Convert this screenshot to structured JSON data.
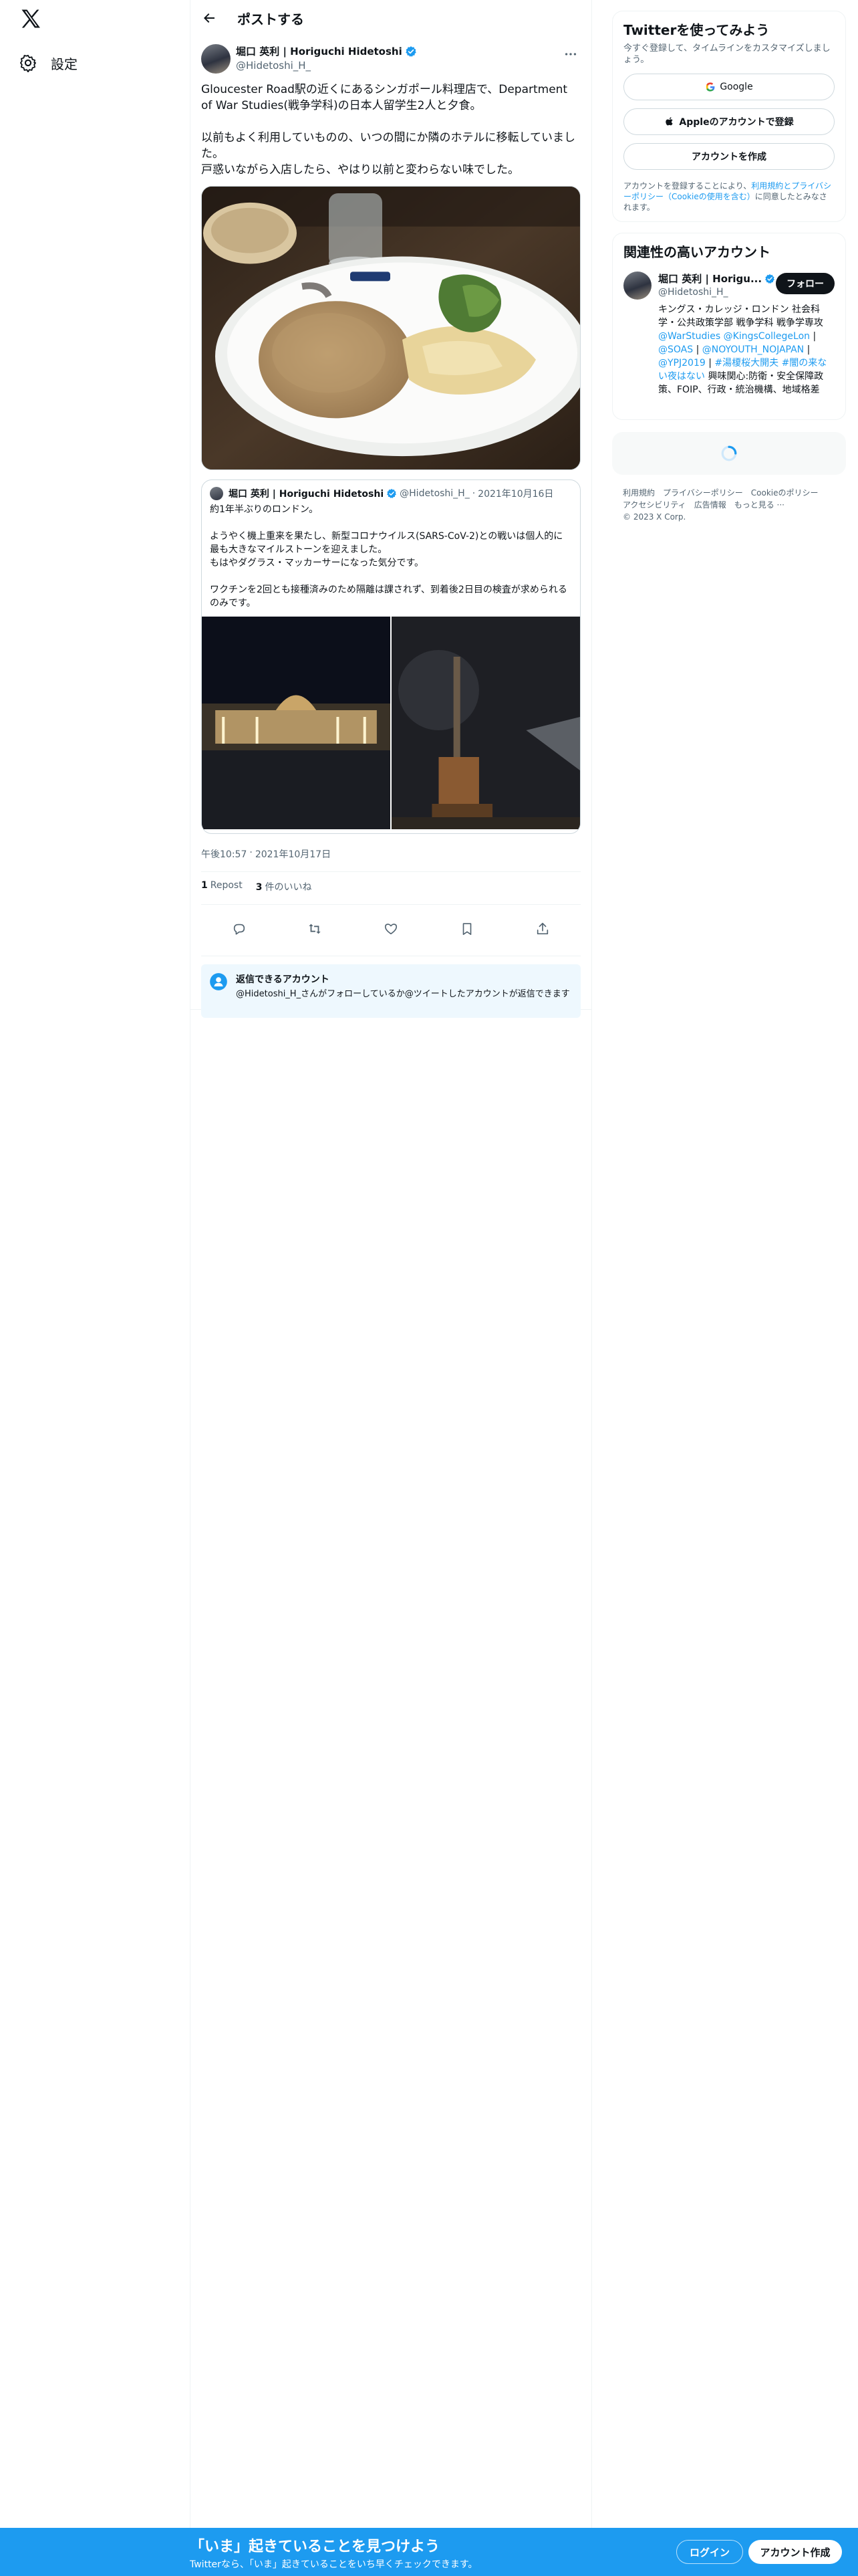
{
  "nav": {
    "logo_icon": "x-logo-icon",
    "settings_label": "設定"
  },
  "header": {
    "title": "ポストする"
  },
  "post": {
    "author_name": "堀口 英利 | Horiguchi Hidetoshi",
    "author_handle": "@Hidetoshi_H_",
    "text": "Gloucester Road駅の近くにあるシンガポール料理店で、Department of War Studies(戦争学科)の日本人留学生2人と夕食。\n\n以前もよく利用していものの、いつの間にか隣のホテルに移転していました。\n戸惑いながら入店したら、やはり以前と変わらない味でした。",
    "timestamp_time": "午後10:57",
    "timestamp_sep": "·",
    "timestamp_date": "2021年10月17日",
    "repost_count": "1",
    "repost_label": "Repost",
    "like_count": "3",
    "like_label": "件のいいね"
  },
  "quote": {
    "author_name": "堀口 英利 | Horiguchi Hidetoshi",
    "author_handle": "@Hidetoshi_H_",
    "sep": "·",
    "date": "2021年10月16日",
    "text": "約1年半ぶりのロンドン。\n\nようやく機上重来を果たし、新型コロナウイルス(SARS-CoV-2)との戦いは個人的に最も大きなマイルストーンを迎えました。\nもはやダグラス・マッカーサーになった気分です。\n\nワクチンを2回とも接種済みのため隔離は課されず、到着後2日目の検査が求められるのみです。"
  },
  "reply_box": {
    "title": "返信できるアカウント",
    "subtitle": "@Hidetoshi_H_さんがフォローしているか@ツイートしたアカウントが返信できます"
  },
  "signup": {
    "title": "Twitterを使ってみよう",
    "subtitle": "今すぐ登録して、タイムラインをカスタマイズしましょう。",
    "google_label": "Google",
    "apple_label": "Appleのアカウントで登録",
    "create_label": "アカウントを作成",
    "terms_prefix": "アカウントを登録することにより、",
    "terms_link1": "利用規約とプライバシーポリシー（Cookieの使用を含む）",
    "terms_suffix": "に同意したとみなされます。"
  },
  "related": {
    "title": "関連性の高いアカウント",
    "name": "堀口 英利 | Horigu...",
    "handle": "@Hidetoshi_H_",
    "follow_label": "フォロー",
    "bio_1": "キングス・カレッジ・ロンドン 社会科学・公共政策学部 戦争学科 戦争学専攻 ",
    "bio_link1": "@WarStudies @KingsCollegeLon",
    "bio_2": " | ",
    "bio_link2": "@SOAS",
    "bio_3": " | ",
    "bio_link3": "@NOYOUTH_NOJAPAN",
    "bio_4": " | ",
    "bio_link4": "@YPJ2019",
    "bio_5": " | ",
    "bio_link5": "#湯榎桜大開夫 #闇の来ない夜はない",
    "bio_6": " 興味関心:防衛・安全保障政策、FOIP、行政・統治機構、地域格差"
  },
  "footer": {
    "links": [
      "利用規約",
      "プライバシーポリシー",
      "Cookieのポリシー",
      "アクセシビリティ",
      "広告情報",
      "もっと見る ···",
      "© 2023 X Corp."
    ]
  },
  "bottom_bar": {
    "title": "「いま」起きていることを見つけよう",
    "subtitle": "Twitterなら、「いま」起きていることをいち早くチェックできます。",
    "login_label": "ログイン",
    "signup_label": "アカウント作成"
  },
  "colors": {
    "accent": "#1d9bf0",
    "text": "#0f1419",
    "muted": "#536471"
  }
}
